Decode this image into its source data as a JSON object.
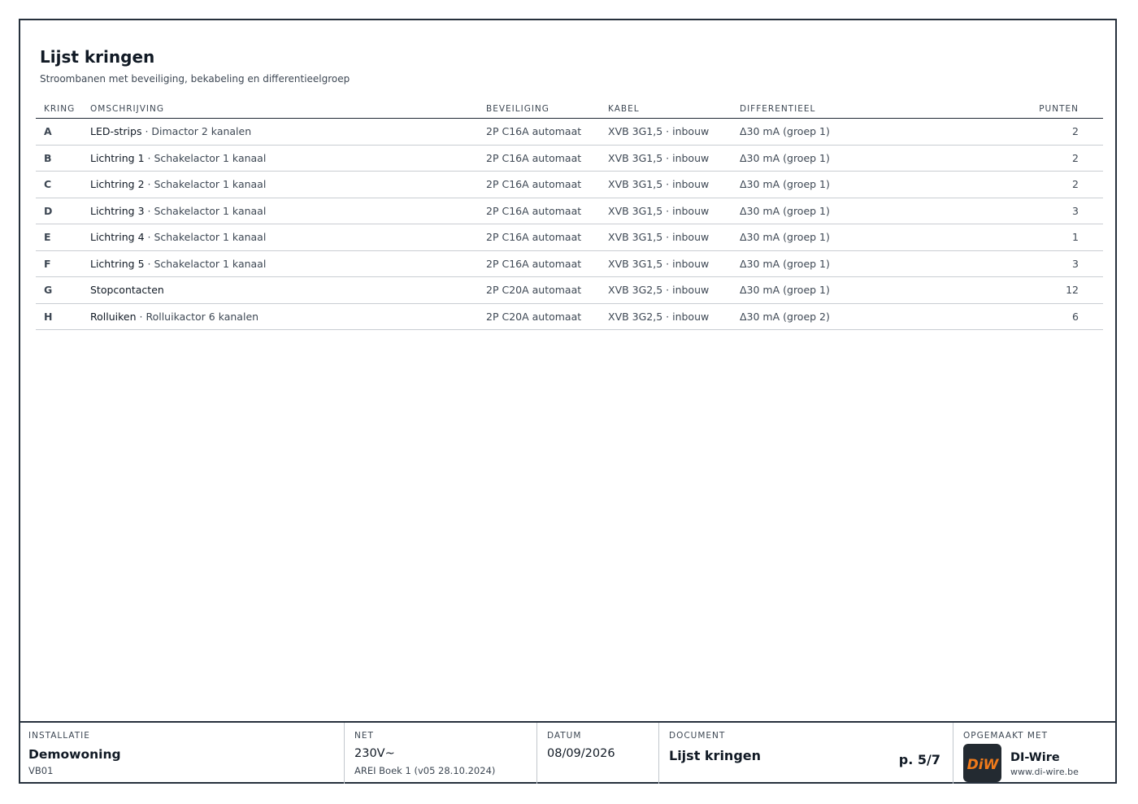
{
  "page": {
    "title": "Lijst kringen",
    "subtitle": "Stroombanen met beveiliging, bekabeling en differentieelgroep"
  },
  "table": {
    "headers": {
      "kring": "KRING",
      "omschrijving": "OMSCHRIJVING",
      "beveiliging": "BEVEILIGING",
      "kabel": "KABEL",
      "differentieel": "DIFFERENTIEEL",
      "punten": "PUNTEN"
    },
    "rows": [
      {
        "kring": "A",
        "main": "LED-strips",
        "sep": " · ",
        "sub": "Dimactor 2 kanalen",
        "beveiliging": "2P C16A automaat",
        "kabel": "XVB 3G1,5 · inbouw",
        "differentieel": "Δ30 mA (groep 1)",
        "punten": "2"
      },
      {
        "kring": "B",
        "main": "Lichtring 1",
        "sep": " · ",
        "sub": "Schakelactor 1 kanaal",
        "beveiliging": "2P C16A automaat",
        "kabel": "XVB 3G1,5 · inbouw",
        "differentieel": "Δ30 mA (groep 1)",
        "punten": "2"
      },
      {
        "kring": "C",
        "main": "Lichtring 2",
        "sep": " · ",
        "sub": "Schakelactor 1 kanaal",
        "beveiliging": "2P C16A automaat",
        "kabel": "XVB 3G1,5 · inbouw",
        "differentieel": "Δ30 mA (groep 1)",
        "punten": "2"
      },
      {
        "kring": "D",
        "main": "Lichtring 3",
        "sep": " · ",
        "sub": "Schakelactor 1 kanaal",
        "beveiliging": "2P C16A automaat",
        "kabel": "XVB 3G1,5 · inbouw",
        "differentieel": "Δ30 mA (groep 1)",
        "punten": "3"
      },
      {
        "kring": "E",
        "main": "Lichtring 4",
        "sep": " · ",
        "sub": "Schakelactor 1 kanaal",
        "beveiliging": "2P C16A automaat",
        "kabel": "XVB 3G1,5 · inbouw",
        "differentieel": "Δ30 mA (groep 1)",
        "punten": "1"
      },
      {
        "kring": "F",
        "main": "Lichtring 5",
        "sep": " · ",
        "sub": "Schakelactor 1 kanaal",
        "beveiliging": "2P C16A automaat",
        "kabel": "XVB 3G1,5 · inbouw",
        "differentieel": "Δ30 mA (groep 1)",
        "punten": "3"
      },
      {
        "kring": "G",
        "main": "Stopcontacten",
        "sep": "",
        "sub": "",
        "beveiliging": "2P C20A automaat",
        "kabel": "XVB 3G2,5 · inbouw",
        "differentieel": "Δ30 mA (groep 1)",
        "punten": "12"
      },
      {
        "kring": "H",
        "main": "Rolluiken",
        "sep": " · ",
        "sub": "Rolluikactor 6 kanalen",
        "beveiliging": "2P C20A automaat",
        "kabel": "XVB 3G2,5 · inbouw",
        "differentieel": "Δ30 mA (groep 2)",
        "punten": "6"
      }
    ]
  },
  "footer": {
    "installatie": {
      "label": "INSTALLATIE",
      "value": "Demowoning",
      "sub": "VB01"
    },
    "net": {
      "label": "NET",
      "value": "230V~",
      "sub": "AREI Boek 1 (v05 28.10.2024)"
    },
    "datum": {
      "label": "DATUM",
      "value": "08/09/2026"
    },
    "document": {
      "label": "DOCUMENT",
      "value": "Lijst kringen",
      "page": "p. 5/7"
    },
    "opgemaakt": {
      "label": "OPGEMAAKT MET",
      "logo_text": "DiW",
      "brand": "DI-Wire",
      "url": "www.di-wire.be"
    }
  },
  "colors": {
    "accent": "#f07a1a",
    "logo_bg": "#232a31",
    "frame": "#26303c"
  }
}
